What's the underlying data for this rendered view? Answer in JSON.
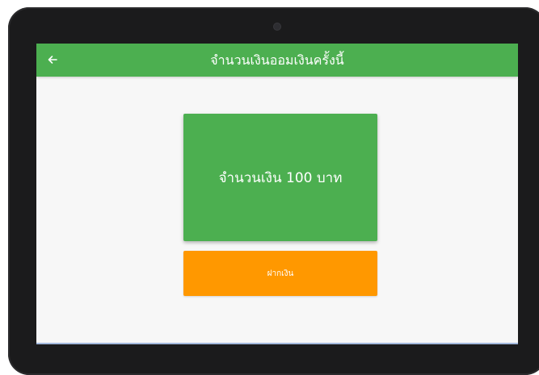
{
  "app_bar": {
    "title": "จำนวนเงินออมเงินครั้งนี้",
    "back_icon": "arrow-left-icon",
    "color": "#4caf50"
  },
  "amount_card": {
    "text": "จำนวนเงิน 100 บาท",
    "color": "#4caf50"
  },
  "deposit_button": {
    "label": "ฝากเงิน",
    "color": "#ff9800"
  }
}
